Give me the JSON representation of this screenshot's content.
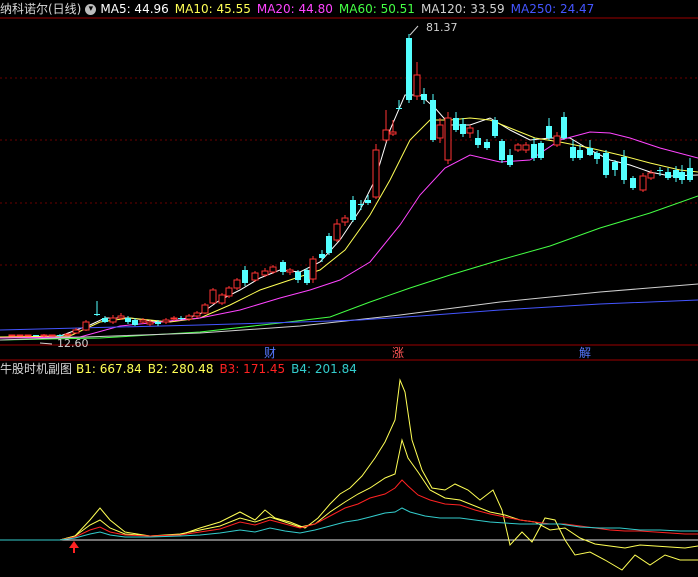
{
  "main_panel": {
    "title": "纳科诺尔(日线)",
    "ma": [
      {
        "label": "MA5: 44.96",
        "color": "#ffffff"
      },
      {
        "label": "MA10: 45.55",
        "color": "#ffff55"
      },
      {
        "label": "MA20: 44.80",
        "color": "#ff44ff"
      },
      {
        "label": "MA60: 50.51",
        "color": "#44ff44"
      },
      {
        "label": "MA120: 33.59",
        "color": "#d0d0d0"
      },
      {
        "label": "MA250: 24.47",
        "color": "#4455ff"
      }
    ],
    "high_label": "81.37",
    "low_label": "12.60",
    "events": [
      {
        "label": "财",
        "color": "#5577ff"
      },
      {
        "label": "涨",
        "color": "#ff5555"
      },
      {
        "label": "解",
        "color": "#5577ff"
      }
    ]
  },
  "sub_panel": {
    "title": "牛股时机副图",
    "items": [
      {
        "label": "B1: 667.84",
        "color": "#ffff55"
      },
      {
        "label": "B2: 280.48",
        "color": "#ffff55"
      },
      {
        "label": "B3: 171.45",
        "color": "#ff2222"
      },
      {
        "label": "B4: 201.84",
        "color": "#33cccc"
      }
    ]
  },
  "colors": {
    "up": "#ff3333",
    "down": "#54ffff",
    "background": "#000000"
  },
  "icons": {
    "collapse": "circle-down-icon",
    "signal": "red-up-arrow-icon"
  }
}
